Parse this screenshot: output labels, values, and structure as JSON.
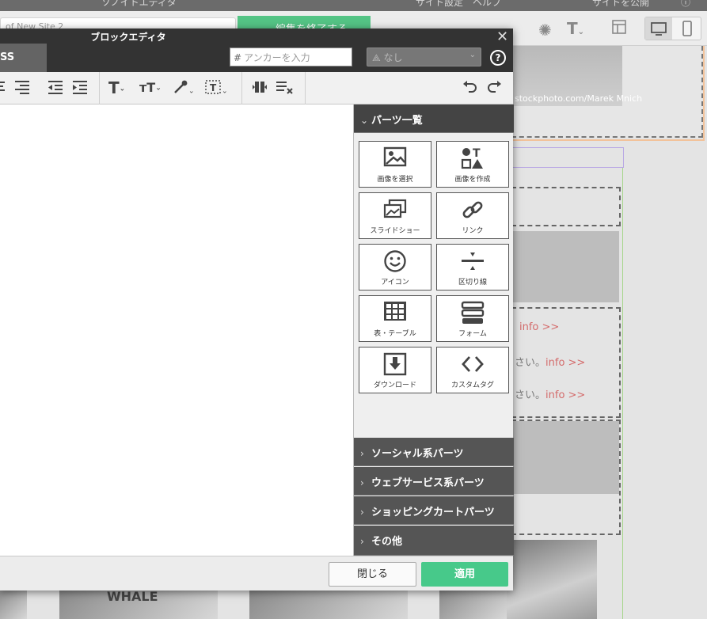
{
  "background": {
    "top_text_left": "ソノイトエディタ",
    "top_text_right": "サイト設定　ヘルプ",
    "top_publish": "サイトを公開",
    "url_text": "of New Site 2",
    "finish_edit_label": "編集を終了する",
    "photo_credit": "stockphoto.com/Marek Mnich",
    "info_rows": [
      {
        "text": "",
        "link": "info >>"
      },
      {
        "text": "さい。",
        "link": "info >>"
      },
      {
        "text": "さい。",
        "link": "info >>"
      }
    ],
    "whale_text": "WHALE"
  },
  "modal": {
    "title": "ブロックエディタ",
    "tab_label": "SS",
    "anchor_placeholder": "アンカーを入力",
    "select_value": "なし",
    "footer": {
      "close_label": "閉じる",
      "apply_label": "適用"
    }
  },
  "parts_panel": {
    "title": "パーツ一覧",
    "parts": [
      {
        "label": "画像を選択",
        "icon": "image-icon"
      },
      {
        "label": "画像を作成",
        "icon": "shapes-icon"
      },
      {
        "label": "スライドショー",
        "icon": "slideshow-icon"
      },
      {
        "label": "リンク",
        "icon": "link-icon"
      },
      {
        "label": "アイコン",
        "icon": "smiley-icon"
      },
      {
        "label": "区切り線",
        "icon": "divider-icon"
      },
      {
        "label": "表・テーブル",
        "icon": "table-icon"
      },
      {
        "label": "フォーム",
        "icon": "form-icon"
      },
      {
        "label": "ダウンロード",
        "icon": "download-icon"
      },
      {
        "label": "カスタムタグ",
        "icon": "code-icon"
      }
    ],
    "categories": [
      {
        "label": "ソーシャル系パーツ"
      },
      {
        "label": "ウェブサービス系パーツ"
      },
      {
        "label": "ショッピングカートパーツ"
      },
      {
        "label": "その他"
      }
    ]
  },
  "colors": {
    "accent_green": "#47c98a",
    "link_red": "#d46b6b",
    "header_dark": "#333333"
  }
}
